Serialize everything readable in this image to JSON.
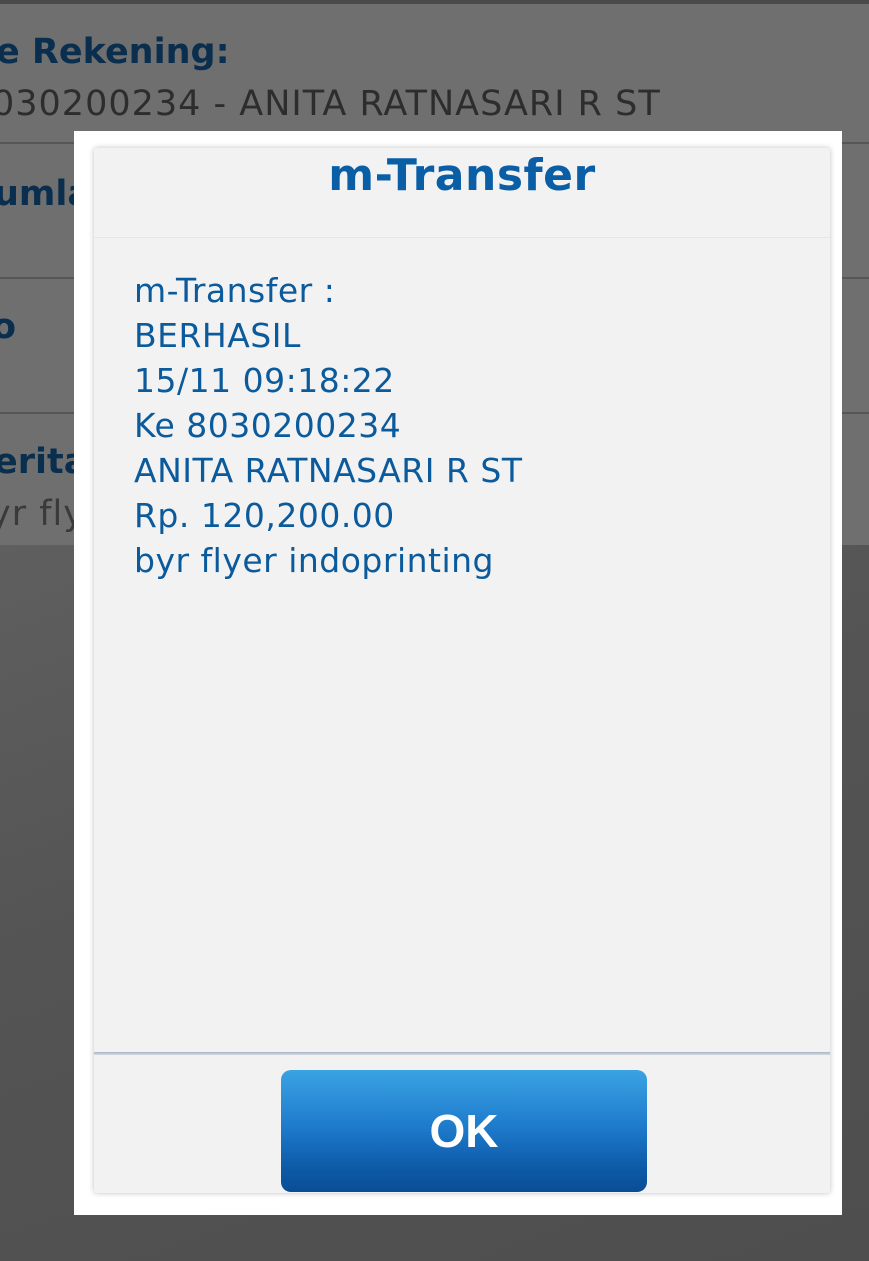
{
  "background_form": {
    "rekening_label": "e Rekening:",
    "rekening_value": "030200234 - ANITA RATNASARI R ST",
    "jumlah_label": "umlah",
    "row3_label": "o",
    "berita_label": "erita:",
    "berita_value": "yr fly"
  },
  "dialog": {
    "title": "m-Transfer",
    "message_lines": [
      "m-Transfer :",
      "BERHASIL",
      "15/11 09:18:22",
      "Ke 8030200234",
      "ANITA RATNASARI R ST",
      "Rp. 120,200.00",
      "byr flyer indoprinting"
    ],
    "ok_label": "OK"
  },
  "colors": {
    "title_blue": "#0a5ea6",
    "message_blue": "#0b5a9c",
    "button_blue": "#1f7ccd"
  }
}
